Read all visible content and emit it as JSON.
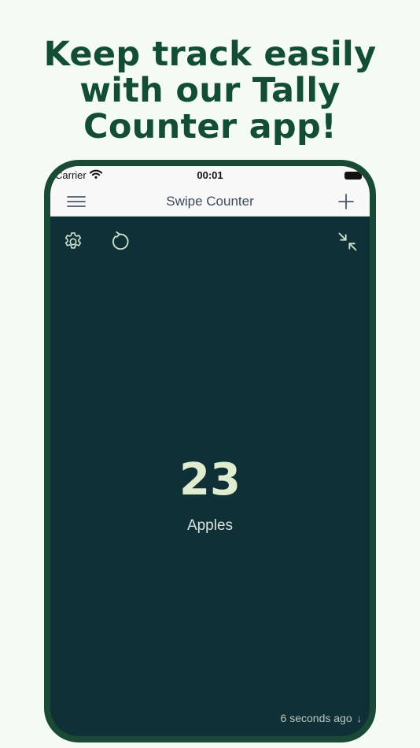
{
  "promo": {
    "headline_lines": [
      "Keep track easily",
      "with our Tally",
      "Counter app!"
    ]
  },
  "status_bar": {
    "carrier": "Carrier",
    "time": "00:01",
    "icons": [
      "wifi-icon",
      "battery-icon"
    ]
  },
  "nav": {
    "title": "Swipe Counter",
    "left_icon": "menu-icon",
    "right_icon": "plus-icon"
  },
  "toolbar": {
    "icons": [
      "gear-icon",
      "reset-icon",
      "collapse-icon"
    ]
  },
  "counter": {
    "value": "23",
    "label": "Apples"
  },
  "footer": {
    "last_update": "6 seconds ago",
    "arrow": "↓"
  },
  "colors": {
    "background": "#f3fbf2",
    "headline": "#134d35",
    "phone_frame": "#1a4a35",
    "screen": "#0e3036",
    "count_text": "#dfeccf"
  }
}
